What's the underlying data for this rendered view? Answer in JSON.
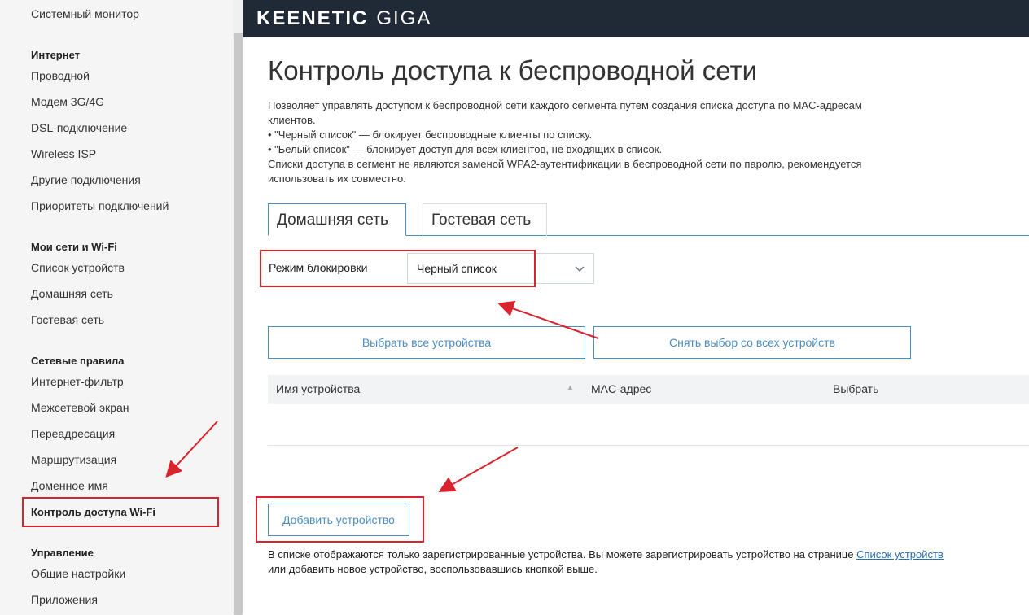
{
  "sidebar": {
    "items": [
      {
        "type": "item",
        "label": "Системный монитор"
      },
      {
        "type": "head",
        "label": "Интернет"
      },
      {
        "type": "item",
        "label": "Проводной"
      },
      {
        "type": "item",
        "label": "Модем 3G/4G"
      },
      {
        "type": "item",
        "label": "DSL-подключение"
      },
      {
        "type": "item",
        "label": "Wireless ISP"
      },
      {
        "type": "item",
        "label": "Другие подключения"
      },
      {
        "type": "item",
        "label": "Приоритеты подключений"
      },
      {
        "type": "head",
        "label": "Мои сети и Wi-Fi"
      },
      {
        "type": "item",
        "label": "Список устройств"
      },
      {
        "type": "item",
        "label": "Домашняя сеть"
      },
      {
        "type": "item",
        "label": "Гостевая сеть"
      },
      {
        "type": "head",
        "label": "Сетевые правила"
      },
      {
        "type": "item",
        "label": "Интернет-фильтр"
      },
      {
        "type": "item",
        "label": "Межсетевой экран"
      },
      {
        "type": "item",
        "label": "Переадресация"
      },
      {
        "type": "item",
        "label": "Маршрутизация"
      },
      {
        "type": "item",
        "label": "Доменное имя"
      },
      {
        "type": "active",
        "label": "Контроль доступа Wi-Fi"
      },
      {
        "type": "head",
        "label": "Управление"
      },
      {
        "type": "item",
        "label": "Общие настройки"
      },
      {
        "type": "item",
        "label": "Приложения"
      }
    ]
  },
  "header": {
    "brand": "KEENETIC",
    "model": "GIGA"
  },
  "page": {
    "title": "Контроль доступа к беспроводной сети",
    "description_lines": [
      "Позволяет управлять доступом к беспроводной сети каждого сегмента путем создания списка доступа по MAC-адресам",
      "клиентов.",
      "• \"Черный список\" — блокирует беспроводные клиенты по списку.",
      "• \"Белый список\" — блокирует доступ для всех клиентов, не входящих в список.",
      "Списки доступа в сегмент не являются заменой WPA2-аутентификации в беспроводной сети по паролю, рекомендуется",
      "использовать их совместно."
    ]
  },
  "tabs": [
    {
      "label": "Домашняя сеть",
      "active": true
    },
    {
      "label": "Гостевая сеть",
      "active": false
    }
  ],
  "blocking": {
    "label": "Режим блокировки",
    "value": "Черный список"
  },
  "buttons": {
    "select_all": "Выбрать все устройства",
    "deselect_all": "Снять выбор со всех устройств",
    "add_device": "Добавить устройство"
  },
  "table": {
    "columns": [
      "Имя устройства",
      "MAC-адрес",
      "Выбрать"
    ]
  },
  "note": {
    "line1_prefix": "В списке отображаются только зарегистрированные устройства. Вы можете зарегистрировать устройство на странице ",
    "link": "Список устройств",
    "line2": "или добавить новое устройство, воспользовавшись кнопкой выше."
  },
  "colors": {
    "accent": "#4a90c8",
    "header_bg": "#1f2a36",
    "highlight": "#d9232d"
  }
}
